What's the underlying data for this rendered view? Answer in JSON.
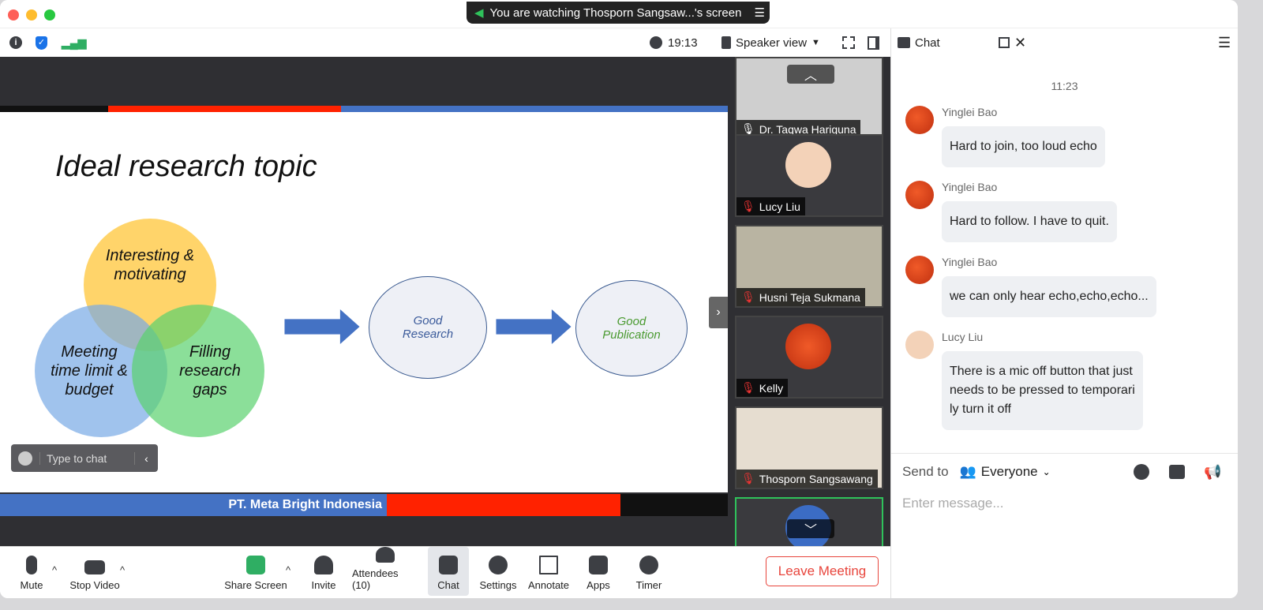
{
  "banner": {
    "text": "You are watching Thosporn Sangsaw...'s screen"
  },
  "topbar": {
    "time": "19:13",
    "view": "Speaker view"
  },
  "slide": {
    "title": "Ideal research topic",
    "circles": [
      "Interesting & motivating",
      "Meeting time limit & budget",
      "Filling research gaps"
    ],
    "steps": [
      "Good Research",
      "Good Publication"
    ],
    "footer": "PT. Meta Bright Indonesia"
  },
  "typechat": {
    "placeholder": "Type to chat"
  },
  "participants": [
    "Dr. Taqwa Hariguna",
    "Lucy Liu",
    "Husni Teja Sukmana",
    "Kelly",
    "Thosporn Sangsawang"
  ],
  "chat": {
    "title": "Chat",
    "timestamp": "11:23",
    "messages": [
      {
        "sender": "Yinglei Bao",
        "text": "Hard to join, too loud echo"
      },
      {
        "sender": "Yinglei Bao",
        "text": "Hard to follow. I have to quit."
      },
      {
        "sender": "Yinglei Bao",
        "text": "we can only hear echo,echo,echo..."
      },
      {
        "sender": "Lucy Liu",
        "lines": [
          "There is a mic off button that just",
          "needs to be pressed to temporari",
          "ly turn it off"
        ]
      }
    ],
    "send_to_label": "Send to",
    "recipient": "Everyone",
    "input_placeholder": "Enter message..."
  },
  "toolbar": {
    "mute": "Mute",
    "stop_video": "Stop Video",
    "share": "Share Screen",
    "invite": "Invite",
    "attendees": "Attendees (10)",
    "chat": "Chat",
    "settings": "Settings",
    "annotate": "Annotate",
    "apps": "Apps",
    "timer": "Timer",
    "leave": "Leave Meeting"
  },
  "colors": {
    "share_green": "#2fae63",
    "leave_red": "#e8453c",
    "slide_blue": "#4472c4",
    "slide_red": "#ff2200"
  }
}
